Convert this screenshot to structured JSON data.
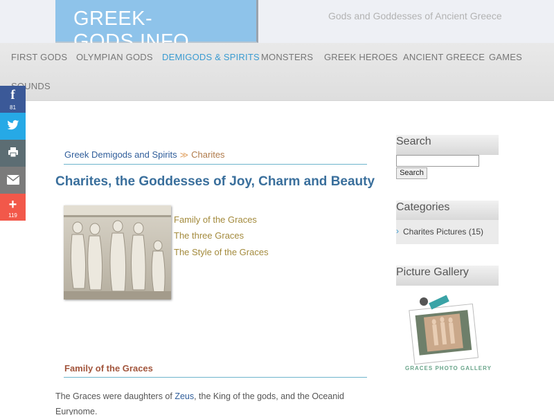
{
  "site": {
    "logo": "GREEK-GODS.INFO",
    "tagline": "Gods and Goddesses of Ancient Greece"
  },
  "nav": {
    "items": [
      {
        "label": "FIRST GODS"
      },
      {
        "label": "OLYMPIAN GODS"
      },
      {
        "label": "DEMIGODS & SPIRITS",
        "active": true
      },
      {
        "label": "MONSTERS"
      },
      {
        "label": "GREEK HEROES"
      },
      {
        "label": "ANCIENT GREECE"
      },
      {
        "label": "GAMES"
      },
      {
        "label": "SOUNDS"
      }
    ]
  },
  "social": {
    "facebook_count": "81",
    "share_count": "119",
    "icons": [
      "facebook-icon",
      "twitter-icon",
      "print-icon",
      "email-icon",
      "plus-icon"
    ]
  },
  "breadcrumb": {
    "parent": "Greek Demigods and Spirits",
    "separator": "≫",
    "current": "Charites"
  },
  "page": {
    "title": "Charites, the Goddesses of Joy, Charm and Beauty",
    "toc": [
      "Family of the Graces",
      "The three Graces",
      "The Style of the Graces"
    ],
    "section_heading": "Family of the Graces",
    "body_pre": "The Graces were daughters of ",
    "body_link": "Zeus",
    "body_post": ", the King of the gods, and the Oceanid Eurynome."
  },
  "sidebar": {
    "search_title": "Search",
    "search_button": "Search",
    "categories_title": "Categories",
    "categories": [
      {
        "label": "Charites Pictures (15)"
      }
    ],
    "gallery_title": "Picture Gallery",
    "gallery_caption": "GRACES PHOTO GALLERY"
  },
  "colors": {
    "accent": "#3a9bd1",
    "logo_bg": "#8ec3ea",
    "link": "#2f5d9a",
    "toc_link": "#a38a3c"
  }
}
